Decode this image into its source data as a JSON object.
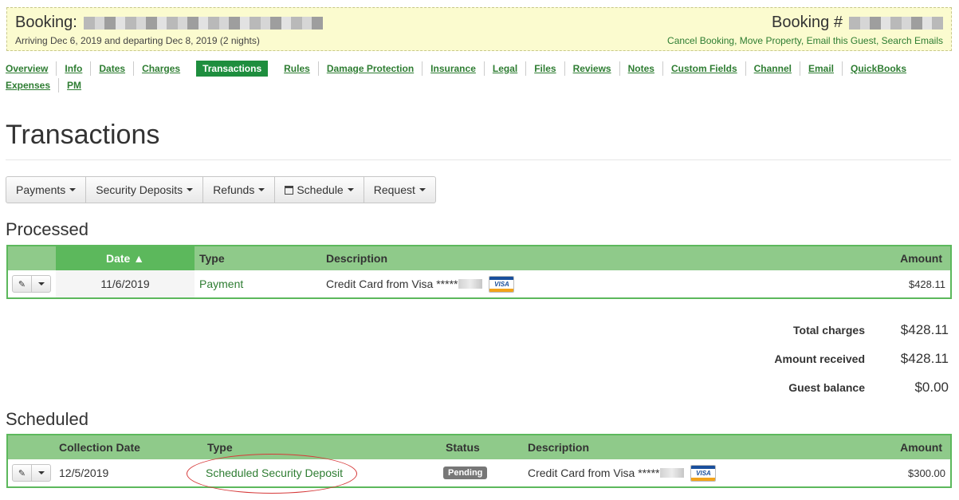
{
  "header": {
    "booking_label": "Booking:",
    "dates_text": "Arriving Dec 6, 2019 and departing Dec 8, 2019 (2 nights)",
    "booking_num_label": "Booking #",
    "actions": [
      "Cancel Booking",
      "Move Property",
      "Email this Guest",
      "Search Emails"
    ]
  },
  "nav": {
    "row1": [
      "Overview",
      "Info",
      "Dates",
      "Charges",
      "Transactions",
      "Rules",
      "Damage Protection",
      "Insurance",
      "Legal",
      "Files",
      "Reviews",
      "Notes",
      "Custom Fields",
      "Channel",
      "Email",
      "QuickBooks"
    ],
    "row2": [
      "Expenses",
      "PM"
    ],
    "active": "Transactions"
  },
  "page_title": "Transactions",
  "toolbar": {
    "payments": "Payments",
    "security_deposits": "Security Deposits",
    "refunds": "Refunds",
    "schedule": "Schedule",
    "request": "Request"
  },
  "processed": {
    "heading": "Processed",
    "columns": {
      "date": "Date ▲",
      "type": "Type",
      "description": "Description",
      "amount": "Amount"
    },
    "rows": [
      {
        "date": "11/6/2019",
        "type": "Payment",
        "description": "Credit Card from Visa *****",
        "card": "VISA",
        "amount": "$428.11"
      }
    ]
  },
  "totals": {
    "total_charges_label": "Total charges",
    "total_charges": "$428.11",
    "amount_received_label": "Amount received",
    "amount_received": "$428.11",
    "guest_balance_label": "Guest balance",
    "guest_balance": "$0.00"
  },
  "scheduled": {
    "heading": "Scheduled",
    "columns": {
      "collection_date": "Collection Date",
      "type": "Type",
      "status": "Status",
      "description": "Description",
      "amount": "Amount"
    },
    "rows": [
      {
        "date": "12/5/2019",
        "type": "Scheduled Security Deposit",
        "status": "Pending",
        "description": "Credit Card from Visa *****",
        "card": "VISA",
        "amount": "$300.00"
      }
    ]
  },
  "colors": {
    "accent_green": "#1e8e3e",
    "link_green": "#2e7d32",
    "header_bg": "#fbfbcf",
    "table_head": "#8fca8a",
    "annotation_red": "#d63a3a"
  }
}
